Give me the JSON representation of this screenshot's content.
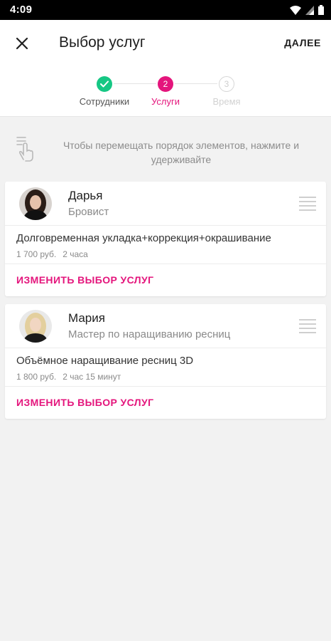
{
  "status_bar": {
    "time": "4:09",
    "icons": [
      "wifi-icon",
      "signal-icon",
      "battery-icon"
    ]
  },
  "header": {
    "title": "Выбор услуг",
    "next_label": "ДАЛЕЕ",
    "close_icon": "close-icon"
  },
  "stepper": {
    "steps": [
      {
        "label": "Сотрудники",
        "marker": "",
        "state": "done"
      },
      {
        "label": "Услуги",
        "marker": "2",
        "state": "active"
      },
      {
        "label": "Время",
        "marker": "3",
        "state": "pending"
      }
    ]
  },
  "hint": {
    "text": "Чтобы перемещать порядок элементов, нажмите и удерживайте",
    "icon": "touch-hold-icon"
  },
  "employees": [
    {
      "name": "Дарья",
      "role": "Бровист",
      "service": {
        "name": "Долговременная укладка+коррекция+окрашивание",
        "price": "1 700 руб.",
        "duration": "2 часа"
      },
      "change_label": "ИЗМЕНИТЬ ВЫБОР УСЛУГ"
    },
    {
      "name": "Мария",
      "role": "Мастер по наращиванию ресниц",
      "service": {
        "name": "Объёмное наращивание ресниц 3D",
        "price": "1 800 руб.",
        "duration": "2 час 15 минут"
      },
      "change_label": "ИЗМЕНИТЬ ВЫБОР УСЛУГ"
    }
  ],
  "colors": {
    "accent": "#e4157c",
    "done": "#16c784",
    "pending": "#d6d6d6",
    "background": "#f2f2f2"
  }
}
